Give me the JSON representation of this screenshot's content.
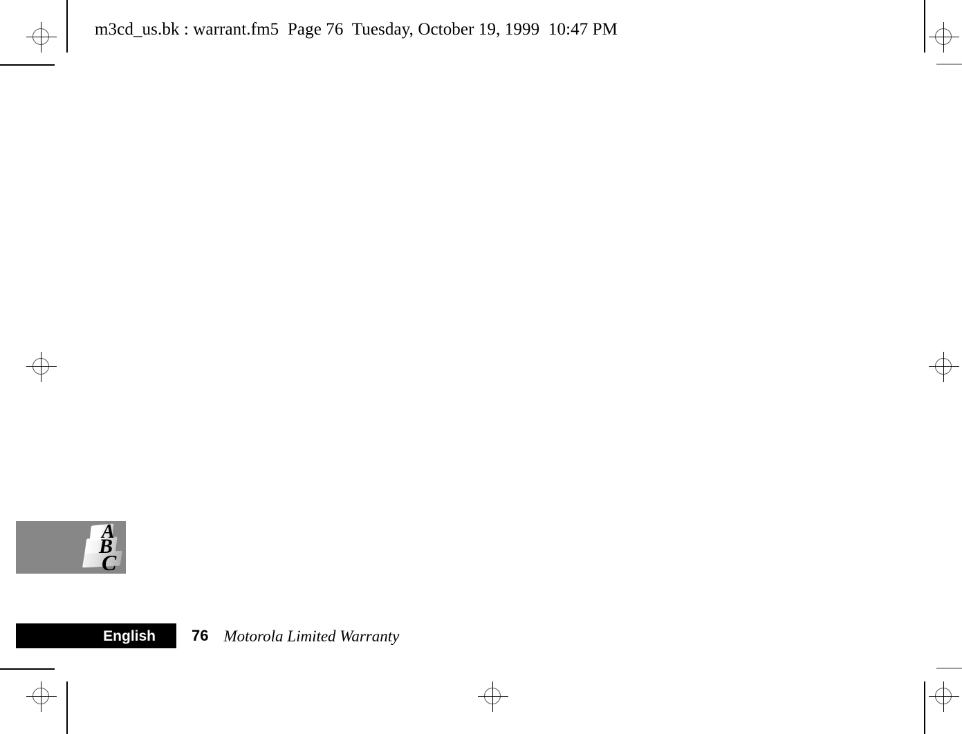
{
  "header": {
    "stamp": "m3cd_us.bk : warrant.fm5  Page 76  Tuesday, October 19, 1999  10:47 PM",
    "file_name": "m3cd_us.bk",
    "source_file": "warrant.fm5",
    "page_label": "Page 76",
    "timestamp": "Tuesday, October 19, 1999  10:47 PM"
  },
  "logo": {
    "name": "abc-logo",
    "letters": [
      "A",
      "B",
      "C"
    ],
    "plate_color": "#878787"
  },
  "footer": {
    "language": "English",
    "page_number": "76",
    "section_title": "Motorola Limited Warranty",
    "bar_color": "#000000",
    "bar_text_color": "#ffffff"
  },
  "marks": {
    "registration_icon": "registration-target-icon",
    "trim_line_color": "#000000",
    "trim_line_gray": "#9a9a9a"
  },
  "content": {
    "body_text": ""
  }
}
